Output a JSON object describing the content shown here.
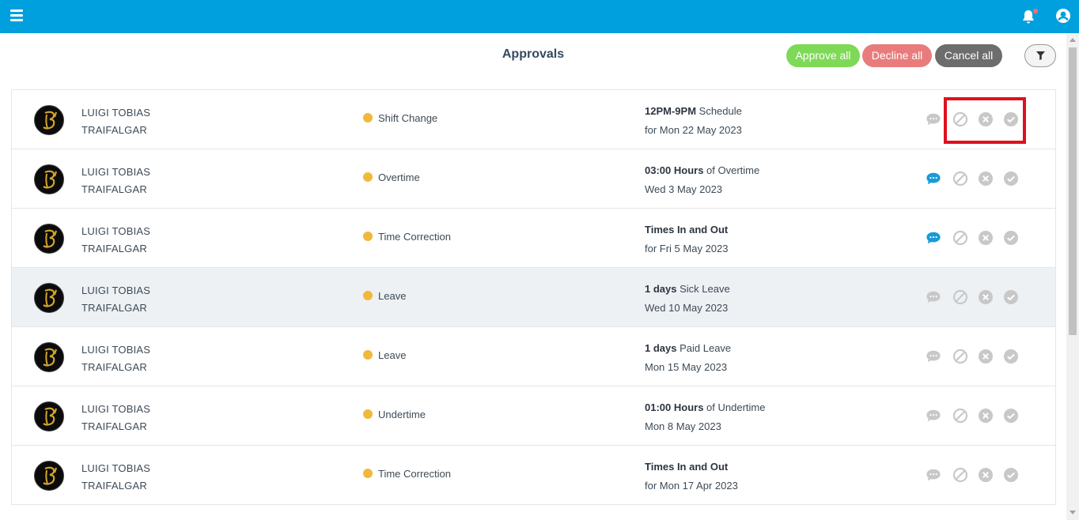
{
  "header": {
    "bg_color": "#00a0df",
    "menu_icon": "hamburger-icon",
    "bell_icon": "bell-icon",
    "user_icon": "user-icon"
  },
  "page": {
    "title": "Approvals"
  },
  "toolbar": {
    "approve_all": "Approve all",
    "decline_all": "Decline all",
    "cancel_all": "Cancel all",
    "filter_icon": "filter-icon"
  },
  "rows": [
    {
      "first": "LUIGI TOBIAS",
      "last": "TRAIFALGAR",
      "type": "Shift Change",
      "bold": "12PM-9PM",
      "rest": "Schedule",
      "date": "for Mon 22 May 2023",
      "comment_active": false,
      "highlight": false
    },
    {
      "first": "LUIGI TOBIAS",
      "last": "TRAIFALGAR",
      "type": "Overtime",
      "bold": "03:00 Hours",
      "rest": "of Overtime",
      "date": "Wed 3 May 2023",
      "comment_active": true,
      "highlight": false
    },
    {
      "first": "LUIGI TOBIAS",
      "last": "TRAIFALGAR",
      "type": "Time Correction",
      "bold": "Times In and Out",
      "rest": "",
      "date": "for Fri 5 May 2023",
      "comment_active": true,
      "highlight": false
    },
    {
      "first": "LUIGI TOBIAS",
      "last": "TRAIFALGAR",
      "type": "Leave",
      "bold": "1 days",
      "rest": "Sick Leave",
      "date": "Wed 10 May 2023",
      "comment_active": false,
      "highlight": true
    },
    {
      "first": "LUIGI TOBIAS",
      "last": "TRAIFALGAR",
      "type": "Leave",
      "bold": "1 days",
      "rest": "Paid Leave",
      "date": "Mon 15 May 2023",
      "comment_active": false,
      "highlight": false
    },
    {
      "first": "LUIGI TOBIAS",
      "last": "TRAIFALGAR",
      "type": "Undertime",
      "bold": "01:00 Hours",
      "rest": "of Undertime",
      "date": "Mon 8 May 2023",
      "comment_active": false,
      "highlight": false
    },
    {
      "first": "LUIGI TOBIAS",
      "last": "TRAIFALGAR",
      "type": "Time Correction",
      "bold": "Times In and Out",
      "rest": "",
      "date": "for Mon 17 Apr 2023",
      "comment_active": false,
      "highlight": false
    }
  ],
  "colors": {
    "status_dot": "#f0b93a",
    "comment_active": "#1a9ad6",
    "icon_inactive": "#c8c8c8",
    "annotation": "#e0101e"
  }
}
